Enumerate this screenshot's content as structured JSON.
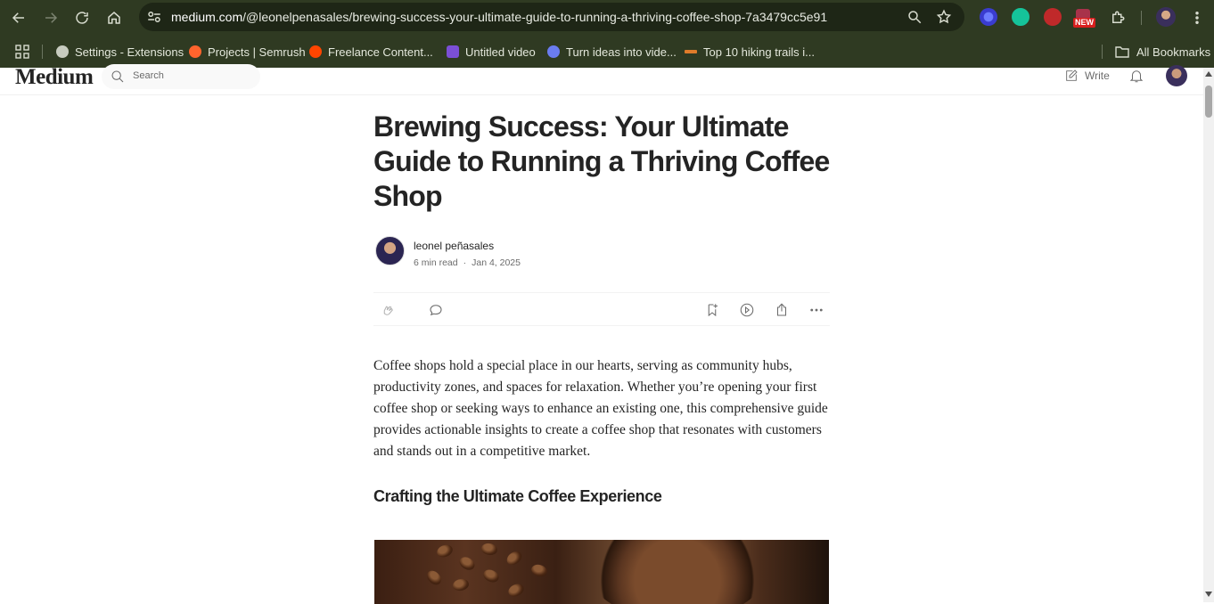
{
  "browser": {
    "url_host": "medium.com",
    "url_path": "/@leonelpenasales/brewing-success-your-ultimate-guide-to-running-a-thriving-coffee-shop-7a3479cc5e91",
    "new_badge": "NEW",
    "bookmarks": [
      {
        "label": "Settings - Extensions",
        "icon": "gear-icon",
        "color": "#c7cbbf"
      },
      {
        "label": "Projects | Semrush",
        "icon": "semrush-icon",
        "color": "#ff642d"
      },
      {
        "label": "Freelance Content...",
        "icon": "reddit-icon",
        "color": "#ff4500"
      },
      {
        "label": "Untitled video",
        "icon": "video-icon",
        "color": "#7b4fd6"
      },
      {
        "label": "Turn ideas into vide...",
        "icon": "planet-icon",
        "color": "#6a7cf0"
      },
      {
        "label": "Top 10 hiking trails i...",
        "icon": "site-icon",
        "color": "#e07b2a"
      }
    ],
    "all_bookmarks": "All Bookmarks"
  },
  "medium": {
    "logo": "Medium",
    "search_placeholder": "Search",
    "write_label": "Write"
  },
  "article": {
    "title": "Brewing Success: Your Ultimate Guide to Running a Thriving Coffee Shop",
    "author": "leonel peñasales",
    "read_time": "6 min read",
    "dot": "·",
    "date": "Jan 4, 2025",
    "intro": "Coffee shops hold a special place in our hearts, serving as community hubs, productivity zones, and spaces for relaxation. Whether you’re opening your first coffee shop or seeking ways to enhance an existing one, this comprehensive guide provides actionable insights to create a coffee shop that resonates with customers and stands out in a competitive market.",
    "section_heading": "Crafting the Ultimate Coffee Experience"
  },
  "colors": {
    "chrome_bg": "#2f3a22",
    "omnibox_bg": "#1e2616",
    "text_primary": "#242424",
    "text_secondary": "#6b6b6b"
  }
}
